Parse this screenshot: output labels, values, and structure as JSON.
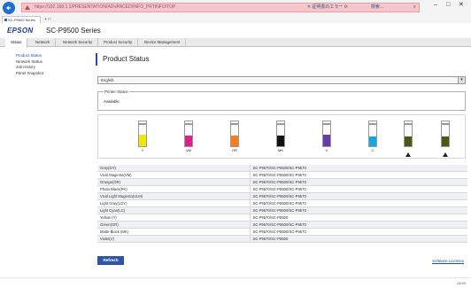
{
  "browser": {
    "url": "https://192.168.1.1/PRESENTATION/ADVANCED/INFO_PRTINFO/TOP",
    "tools": "✕ 証明書のエラー ⟳",
    "search": "検索...",
    "tab_title": "SC-P9500 Series",
    "zoom": "100%"
  },
  "header": {
    "brand": "EPSON",
    "model": "SC-P9500 Series"
  },
  "menu": [
    {
      "label": "Status"
    },
    {
      "label": "Network"
    },
    {
      "label": "Network Security"
    },
    {
      "label": "Product Security"
    },
    {
      "label": "Device Management"
    }
  ],
  "sidebar": [
    {
      "label": "Product Status"
    },
    {
      "label": "Network Status"
    },
    {
      "label": "Job History"
    },
    {
      "label": "Panel Snapshot"
    }
  ],
  "main": {
    "title": "Product Status",
    "language": "English",
    "status_label": "Printer Status",
    "status_value": "Available",
    "refresh_label": "Refresh",
    "license_label": "Software Licenses"
  },
  "inks": [
    {
      "code": "Y",
      "color": "#f3e600",
      "level": 0.55,
      "warn": false
    },
    {
      "code": "VM",
      "color": "#e0208a",
      "level": 0.5,
      "warn": false
    },
    {
      "code": "OR",
      "color": "#ff7a1a",
      "level": 0.5,
      "warn": false
    },
    {
      "code": "MK",
      "color": "#111111",
      "level": 0.5,
      "warn": false
    },
    {
      "code": "V",
      "color": "#6a3aa8",
      "level": 0.55,
      "warn": false
    },
    {
      "code": "C",
      "color": "#18a8e0",
      "level": 0.45,
      "warn": false
    },
    {
      "code": "",
      "color": "#4a5a10",
      "level": 0.45,
      "warn": true
    },
    {
      "code": "",
      "color": "#4a5a10",
      "level": 0.45,
      "warn": true
    }
  ],
  "ink_rows": [
    {
      "name": "Gray(GY)",
      "detail": "SC-P9570/SC-P9500/SC-P9570"
    },
    {
      "name": "Vivid Magenta(VM)",
      "detail": "SC-P9570/SC-P9500/SC-P9570"
    },
    {
      "name": "Orange(OR)",
      "detail": "SC-P9570/SC-P9500/SC-P9570"
    },
    {
      "name": "Photo Black(PK)",
      "detail": "SC-P9570/SC-P9500/SC-P9570"
    },
    {
      "name": "Vivid Light Magenta(VLM)",
      "detail": "SC-P9570/SC-P9500/SC-P9570"
    },
    {
      "name": "Light Gray(LGY)",
      "detail": "SC-P9570/SC-P9500/SC-P9570"
    },
    {
      "name": "Light Cyan(LC)",
      "detail": "SC-P9570/SC-P9500/SC-P9570"
    },
    {
      "name": "Yellow (Y)",
      "detail": "SC-P9570/SC-P9500"
    },
    {
      "name": "Green(GR)",
      "detail": "SC-P9570/SC-P9500/SC-P9570"
    },
    {
      "name": "Matte Black (MK)",
      "detail": "SC-P9570/SC-P9500/SC-P9570"
    },
    {
      "name": "Violet(V)",
      "detail": "SC-P9570/SC-P9500"
    }
  ],
  "colors": {
    "brand": "#1a3a8c",
    "accent": "#2f55a8",
    "address_warning": "#f7c6cc"
  }
}
